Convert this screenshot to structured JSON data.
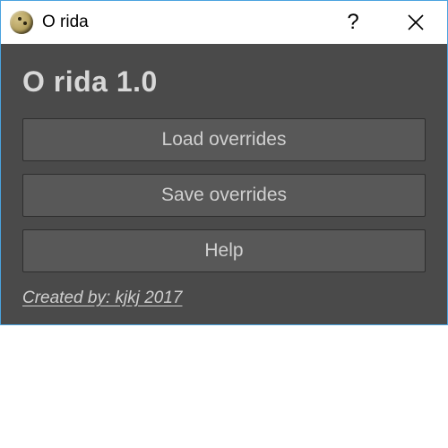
{
  "titlebar": {
    "app_name": "O rida",
    "help_label": "?",
    "close_label": "✕"
  },
  "main": {
    "heading": "O rida 1.0",
    "buttons": {
      "load": "Load overrides",
      "save": "Save overrides",
      "help": "Help"
    },
    "credits": "Created by: kjkj 2017"
  },
  "colors": {
    "client_bg": "#4a4a4a",
    "button_bg": "#585858",
    "accent_border": "#4aa3df"
  }
}
